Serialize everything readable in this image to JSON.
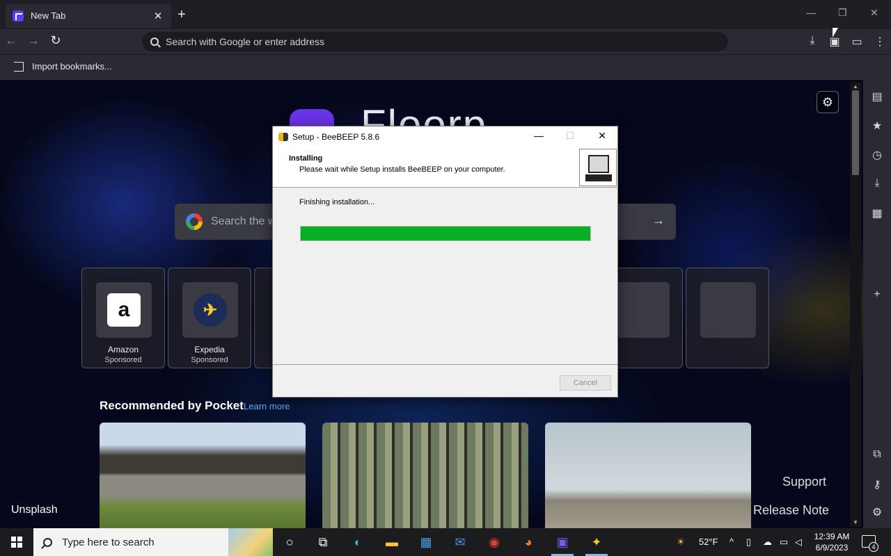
{
  "browser": {
    "tab_title": "New Tab",
    "tab_close": "✕",
    "new_tab": "+",
    "window": {
      "minimize": "—",
      "restore": "❐",
      "close": "✕"
    },
    "url_placeholder": "Search with Google or enter address",
    "nav": {
      "back": "←",
      "forward": "→",
      "reload": "↻"
    },
    "bookmark_item": "Import bookmarks..."
  },
  "newtab": {
    "logo_text": "Floorp",
    "search_placeholder": "Search the web",
    "search_arrow": "→",
    "tiles": [
      {
        "name": "Amazon",
        "sub": "Sponsored",
        "glyph": "a"
      },
      {
        "name": "Expedia",
        "sub": "Sponsored",
        "glyph": "✈"
      }
    ],
    "pocket_title": "Recommended by Pocket",
    "pocket_link": "Learn more",
    "footer_left": "Unsplash",
    "footer_support": "Support",
    "footer_release": "Release Note"
  },
  "dialog": {
    "title": "Setup - BeeBEEP 5.8.6",
    "controls": {
      "minimize": "—",
      "maximize": "☐",
      "close": "✕"
    },
    "header_title": "Installing",
    "header_subtitle": "Please wait while Setup installs BeeBEEP on your computer.",
    "status": "Finishing installation...",
    "progress": 1.0,
    "cancel_label": "Cancel"
  },
  "taskbar": {
    "search_placeholder": "Type here to search",
    "weather": "52°F",
    "time": "12:39 AM",
    "date": "6/9/2023",
    "notifications": "4"
  },
  "colors": {
    "accent": "#5b3df5",
    "progress": "#06b025"
  }
}
